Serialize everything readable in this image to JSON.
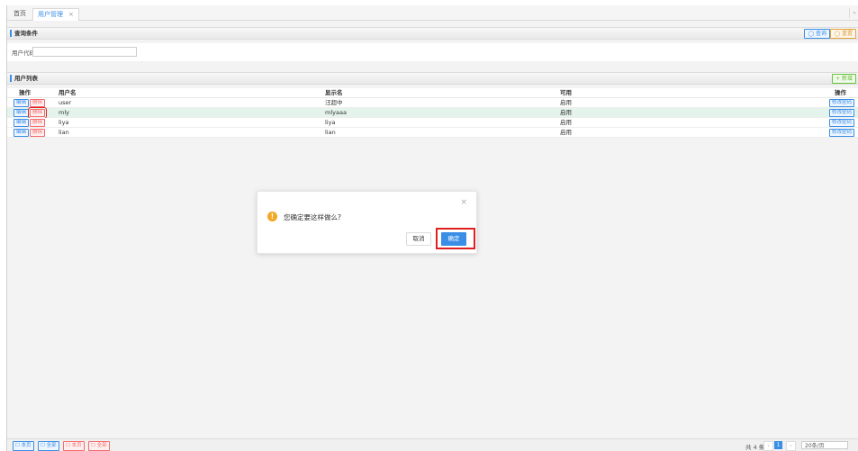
{
  "tabs": {
    "home": "首页",
    "active": "用户管理",
    "close": "×",
    "menu": "⌄"
  },
  "query": {
    "title": "查询条件",
    "search_btn": "◯ 查询",
    "reset_btn": "◯ 重置",
    "field_label": "用户代码",
    "field_value": ""
  },
  "list": {
    "title": "用户列表",
    "add_btn": "+ 新增",
    "headers": {
      "op": "操作",
      "username": "用户名",
      "display": "显示名",
      "enabled": "可用",
      "action": "操作"
    },
    "rows": [
      {
        "edit": "编辑",
        "del": "删除",
        "username": "user",
        "display": "汪超中",
        "enabled": "启用",
        "pwd": "修改密码"
      },
      {
        "edit": "编辑",
        "del": "删除",
        "username": "mly",
        "display": "mlyaaa",
        "enabled": "启用",
        "pwd": "修改密码"
      },
      {
        "edit": "编辑",
        "del": "删除",
        "username": "liya",
        "display": "liya",
        "enabled": "启用",
        "pwd": "修改密码"
      },
      {
        "edit": "编辑",
        "del": "删除",
        "username": "lian",
        "display": "lian",
        "enabled": "启用",
        "pwd": "修改密码"
      }
    ]
  },
  "dialog": {
    "message": "您确定要这样做么?",
    "cancel": "取消",
    "ok": "确定",
    "close": "×",
    "icon": "!"
  },
  "footer": {
    "b1": "☐ 本页",
    "b2": "☐ 全部",
    "b3": "☐ 本页",
    "b4": "☐ 全部",
    "total": "共 4 条",
    "prev": "‹",
    "page": "1",
    "next": "›",
    "page_size": "20条/页"
  }
}
